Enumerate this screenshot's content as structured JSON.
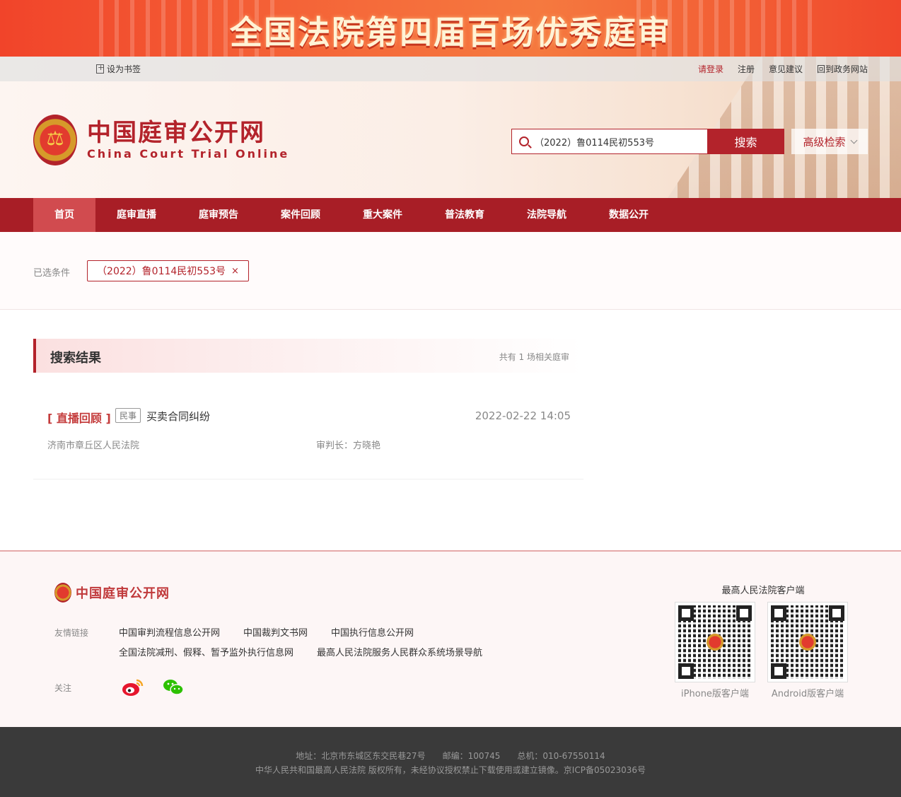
{
  "banner": {
    "title": "全国法院第四届百场优秀庭审"
  },
  "topbar": {
    "bookmark": "设为书签",
    "links": [
      "请登录",
      "注册",
      "意见建议",
      "回到政务网站"
    ]
  },
  "logo": {
    "cn": "中国庭审公开网",
    "en": "China Court Trial Online"
  },
  "search": {
    "value": "（2022）鲁0114民初553号",
    "button": "搜索",
    "advanced": "高级检索"
  },
  "nav": [
    "首页",
    "庭审直播",
    "庭审预告",
    "案件回顾",
    "重大案件",
    "普法教育",
    "法院导航",
    "数据公开"
  ],
  "filter": {
    "label": "已选条件",
    "chip": "（2022）鲁0114民初553号",
    "close": "×"
  },
  "results": {
    "title": "搜索结果",
    "count": "共有 1 场相关庭审",
    "items": [
      {
        "tag": "[ 直播回顾 ]",
        "badge": "民事",
        "title": "买卖合同纠纷",
        "time": "2022-02-22 14:05",
        "court": "济南市章丘区人民法院",
        "judge": "审判长：方晓艳"
      }
    ]
  },
  "footer": {
    "logo": "中国庭审公开网",
    "friend_label": "友情链接",
    "links_row1": [
      "中国审判流程信息公开网",
      "中国裁判文书网",
      "中国执行信息公开网"
    ],
    "links_row2": [
      "全国法院减刑、假释、暂予监外执行信息网",
      "最高人民法院服务人民群众系统场景导航"
    ],
    "follow_label": "关注",
    "qr_title": "最高人民法院客户端",
    "qr_iphone": "iPhone版客户端",
    "qr_android": "Android版客户端"
  },
  "bottom": {
    "line1": "地址：北京市东城区东交民巷27号　　邮编：100745　　总机：010-67550114",
    "line2": "中华人民共和国最高人民法院 版权所有，未经协议授权禁止下载使用或建立镜像。京ICP备05023036号"
  },
  "colors": {
    "brand": "#b3232b",
    "nav": "#a81e26",
    "nav_active": "#d14b4f",
    "banner": "#f1442a"
  }
}
